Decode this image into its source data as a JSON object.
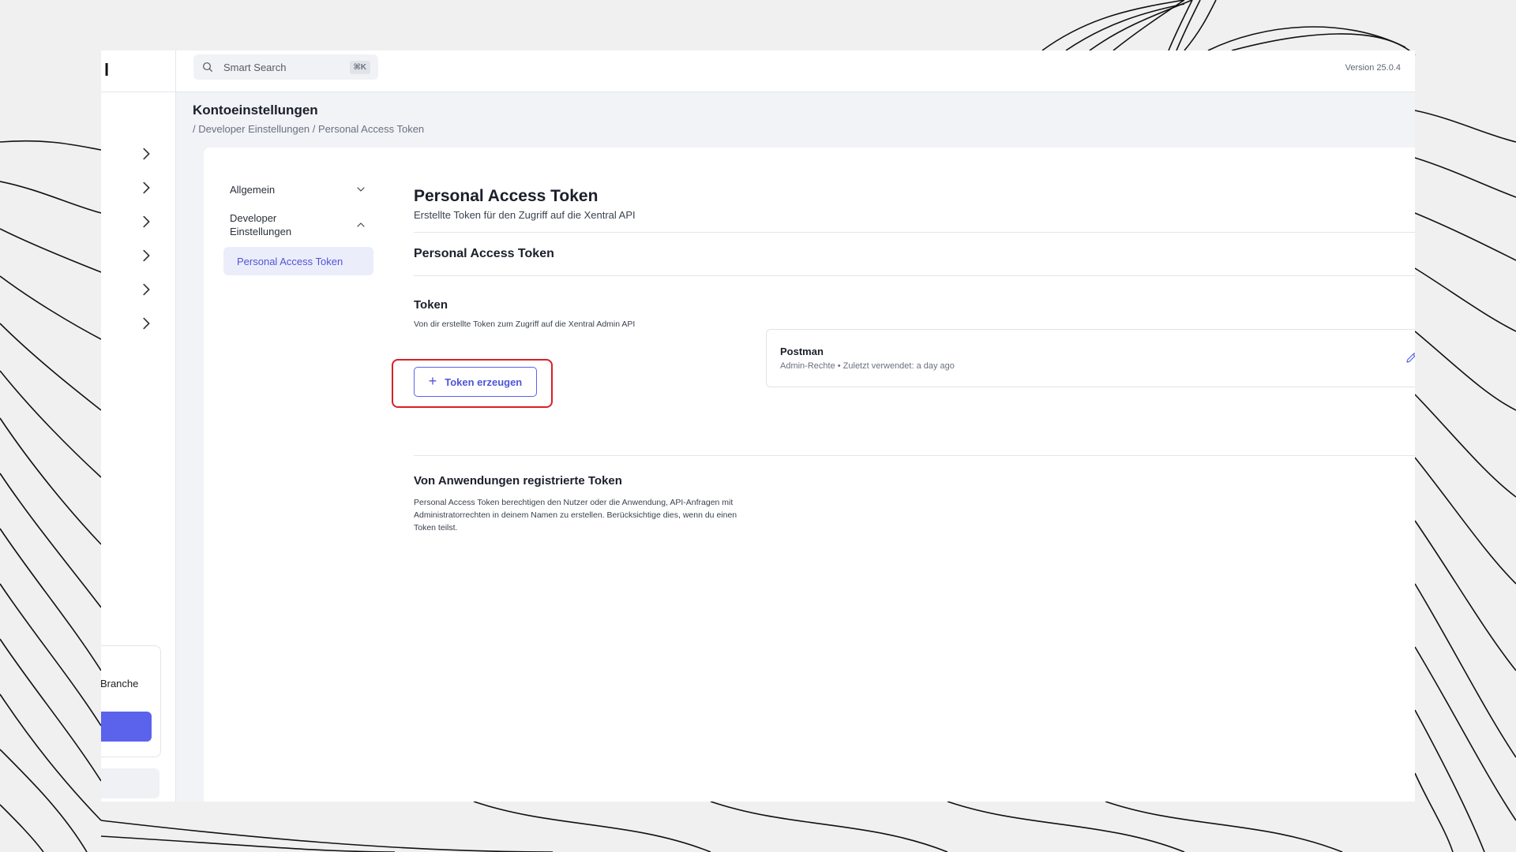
{
  "topbar": {
    "search_placeholder": "Smart Search",
    "search_shortcut": "⌘K",
    "version": "Version 25.0.4"
  },
  "sidebar": {
    "logo": "l",
    "promo_text": "r Branche"
  },
  "page": {
    "title": "Kontoeinstellungen",
    "breadcrumb": "/ Developer Einstellungen / Personal Access Token"
  },
  "subnav": {
    "items": [
      {
        "label": "Allgemein",
        "expanded": false
      },
      {
        "label": "Developer Einstellungen",
        "expanded": true
      },
      {
        "label": "Personal Access Token",
        "active": true
      }
    ]
  },
  "main": {
    "heading": "Personal Access Token",
    "subheading": "Erstellte Token für den Zugriff auf die Xentral API",
    "section_title": "Personal Access Token",
    "token_label": "Token",
    "token_desc": "Von dir erstellte Token zum Zugriff auf die Xentral Admin API",
    "create_button": "Token erzeugen",
    "token_card": {
      "name": "Postman",
      "meta": "Admin-Rechte • Zuletzt verwendet: a day ago"
    },
    "apps_title": "Von Anwendungen registrierte Token",
    "apps_desc": "Personal Access Token berechtigen den Nutzer oder die Anwendung, API-Anfragen mit Administratorrechten in deinem Namen zu erstellen. Berücksichtige dies, wenn du einen Token teilst."
  },
  "colors": {
    "accent": "#5b63ec",
    "highlight": "#d91f26",
    "active_bg": "#ecedfb"
  }
}
